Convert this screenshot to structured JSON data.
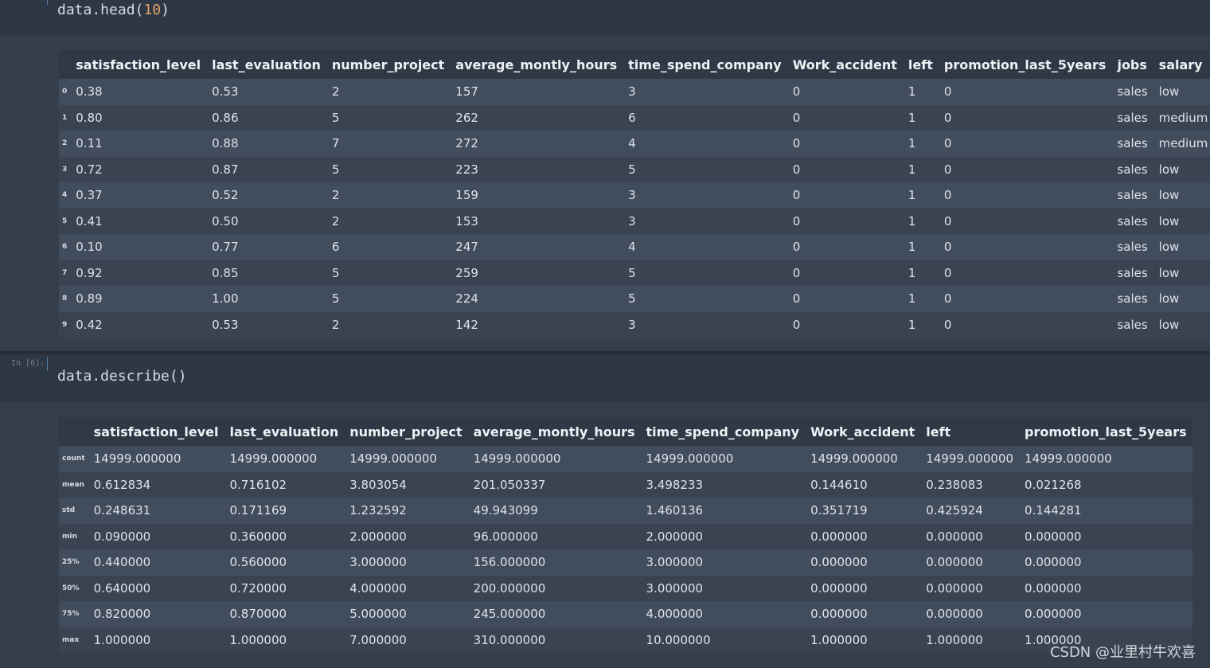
{
  "cell1": {
    "code_fn": "data.head(",
    "code_arg": "10",
    "code_end": ")"
  },
  "cell2": {
    "prompt": "In [6]:",
    "code": "data.describe()"
  },
  "head_table": {
    "columns": [
      "satisfaction_level",
      "last_evaluation",
      "number_project",
      "average_montly_hours",
      "time_spend_company",
      "Work_accident",
      "left",
      "promotion_last_5years",
      "jobs",
      "salary"
    ],
    "rows": [
      {
        "idx": "0",
        "cells": [
          "0.38",
          "0.53",
          "2",
          "157",
          "3",
          "0",
          "1",
          "0",
          "sales",
          "low"
        ]
      },
      {
        "idx": "1",
        "cells": [
          "0.80",
          "0.86",
          "5",
          "262",
          "6",
          "0",
          "1",
          "0",
          "sales",
          "medium"
        ]
      },
      {
        "idx": "2",
        "cells": [
          "0.11",
          "0.88",
          "7",
          "272",
          "4",
          "0",
          "1",
          "0",
          "sales",
          "medium"
        ]
      },
      {
        "idx": "3",
        "cells": [
          "0.72",
          "0.87",
          "5",
          "223",
          "5",
          "0",
          "1",
          "0",
          "sales",
          "low"
        ]
      },
      {
        "idx": "4",
        "cells": [
          "0.37",
          "0.52",
          "2",
          "159",
          "3",
          "0",
          "1",
          "0",
          "sales",
          "low"
        ]
      },
      {
        "idx": "5",
        "cells": [
          "0.41",
          "0.50",
          "2",
          "153",
          "3",
          "0",
          "1",
          "0",
          "sales",
          "low"
        ]
      },
      {
        "idx": "6",
        "cells": [
          "0.10",
          "0.77",
          "6",
          "247",
          "4",
          "0",
          "1",
          "0",
          "sales",
          "low"
        ]
      },
      {
        "idx": "7",
        "cells": [
          "0.92",
          "0.85",
          "5",
          "259",
          "5",
          "0",
          "1",
          "0",
          "sales",
          "low"
        ]
      },
      {
        "idx": "8",
        "cells": [
          "0.89",
          "1.00",
          "5",
          "224",
          "5",
          "0",
          "1",
          "0",
          "sales",
          "low"
        ]
      },
      {
        "idx": "9",
        "cells": [
          "0.42",
          "0.53",
          "2",
          "142",
          "3",
          "0",
          "1",
          "0",
          "sales",
          "low"
        ]
      }
    ]
  },
  "describe_table": {
    "columns": [
      "satisfaction_level",
      "last_evaluation",
      "number_project",
      "average_montly_hours",
      "time_spend_company",
      "Work_accident",
      "left",
      "promotion_last_5years"
    ],
    "rows": [
      {
        "idx": "count",
        "cells": [
          "14999.000000",
          "14999.000000",
          "14999.000000",
          "14999.000000",
          "14999.000000",
          "14999.000000",
          "14999.000000",
          "14999.000000"
        ]
      },
      {
        "idx": "mean",
        "cells": [
          "0.612834",
          "0.716102",
          "3.803054",
          "201.050337",
          "3.498233",
          "0.144610",
          "0.238083",
          "0.021268"
        ]
      },
      {
        "idx": "std",
        "cells": [
          "0.248631",
          "0.171169",
          "1.232592",
          "49.943099",
          "1.460136",
          "0.351719",
          "0.425924",
          "0.144281"
        ]
      },
      {
        "idx": "min",
        "cells": [
          "0.090000",
          "0.360000",
          "2.000000",
          "96.000000",
          "2.000000",
          "0.000000",
          "0.000000",
          "0.000000"
        ]
      },
      {
        "idx": "25%",
        "cells": [
          "0.440000",
          "0.560000",
          "3.000000",
          "156.000000",
          "3.000000",
          "0.000000",
          "0.000000",
          "0.000000"
        ]
      },
      {
        "idx": "50%",
        "cells": [
          "0.640000",
          "0.720000",
          "4.000000",
          "200.000000",
          "3.000000",
          "0.000000",
          "0.000000",
          "0.000000"
        ]
      },
      {
        "idx": "75%",
        "cells": [
          "0.820000",
          "0.870000",
          "5.000000",
          "245.000000",
          "4.000000",
          "0.000000",
          "0.000000",
          "0.000000"
        ]
      },
      {
        "idx": "max",
        "cells": [
          "1.000000",
          "1.000000",
          "7.000000",
          "310.000000",
          "10.000000",
          "1.000000",
          "1.000000",
          "1.000000"
        ]
      }
    ]
  },
  "watermark": "CSDN @业里村牛欢喜"
}
